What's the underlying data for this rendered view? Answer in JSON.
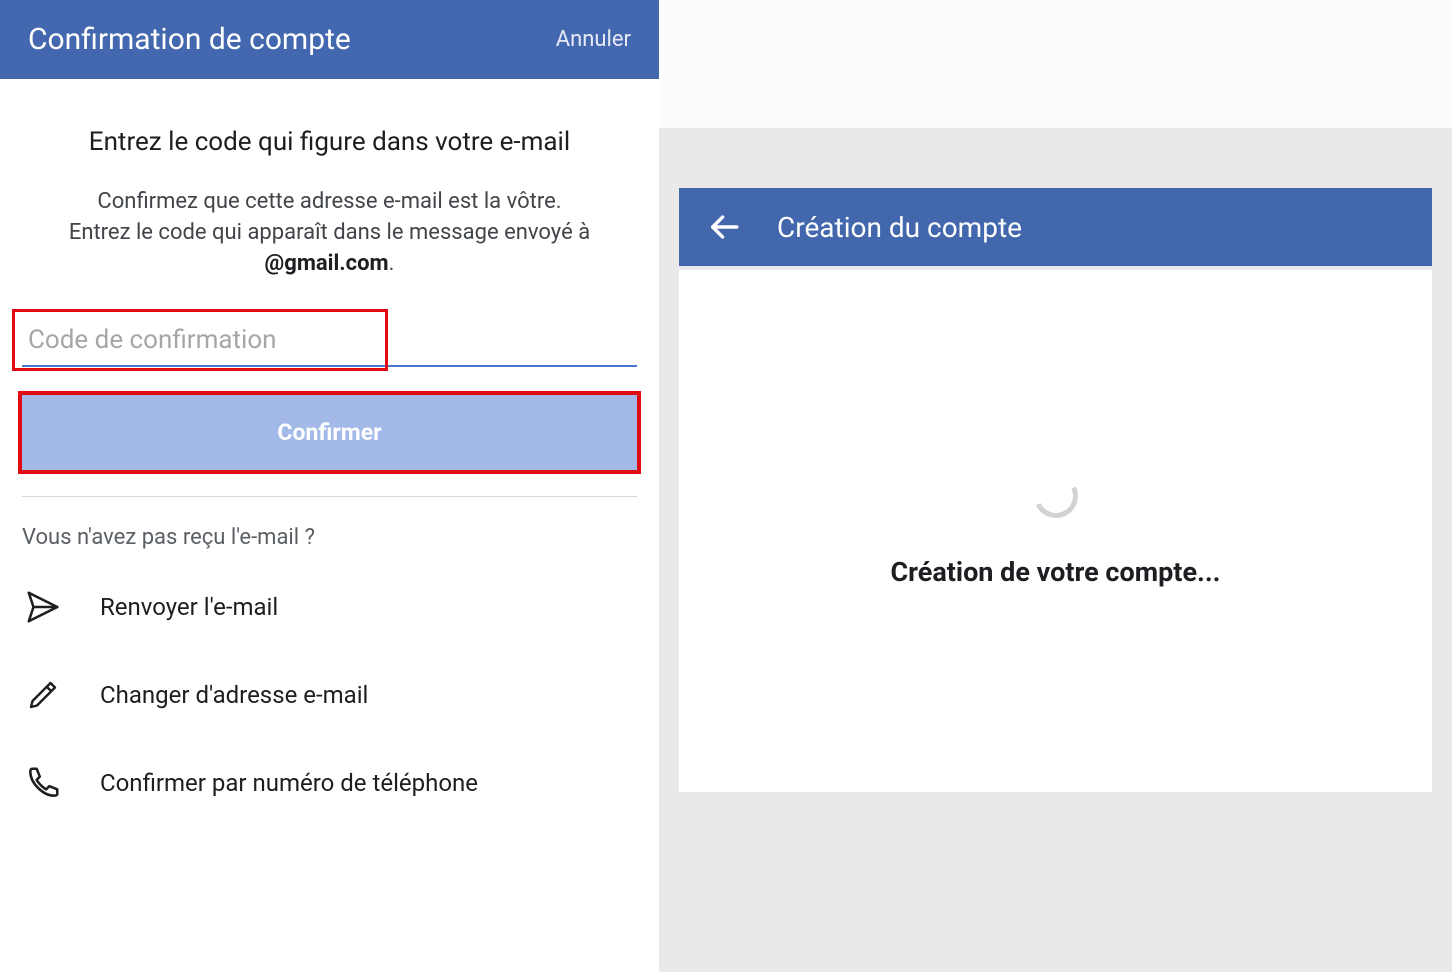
{
  "left": {
    "header_title": "Confirmation de compte",
    "cancel_label": "Annuler",
    "heading": "Entrez le code qui figure dans votre e-mail",
    "subtext_line1": "Confirmez que cette adresse e-mail est la vôtre.",
    "subtext_line2": "Entrez le code qui apparaît dans le message envoyé à",
    "email": "@gmail.com",
    "period": ".",
    "input_placeholder": "Code de confirmation",
    "confirm_label": "Confirmer",
    "noreceive": "Vous n'avez pas reçu l'e-mail ?",
    "options": [
      "Renvoyer l'e-mail",
      "Changer d'adresse e-mail",
      "Confirmer par numéro de téléphone"
    ]
  },
  "right": {
    "header_title": "Création du compte",
    "loading_text": "Création de votre compte..."
  }
}
